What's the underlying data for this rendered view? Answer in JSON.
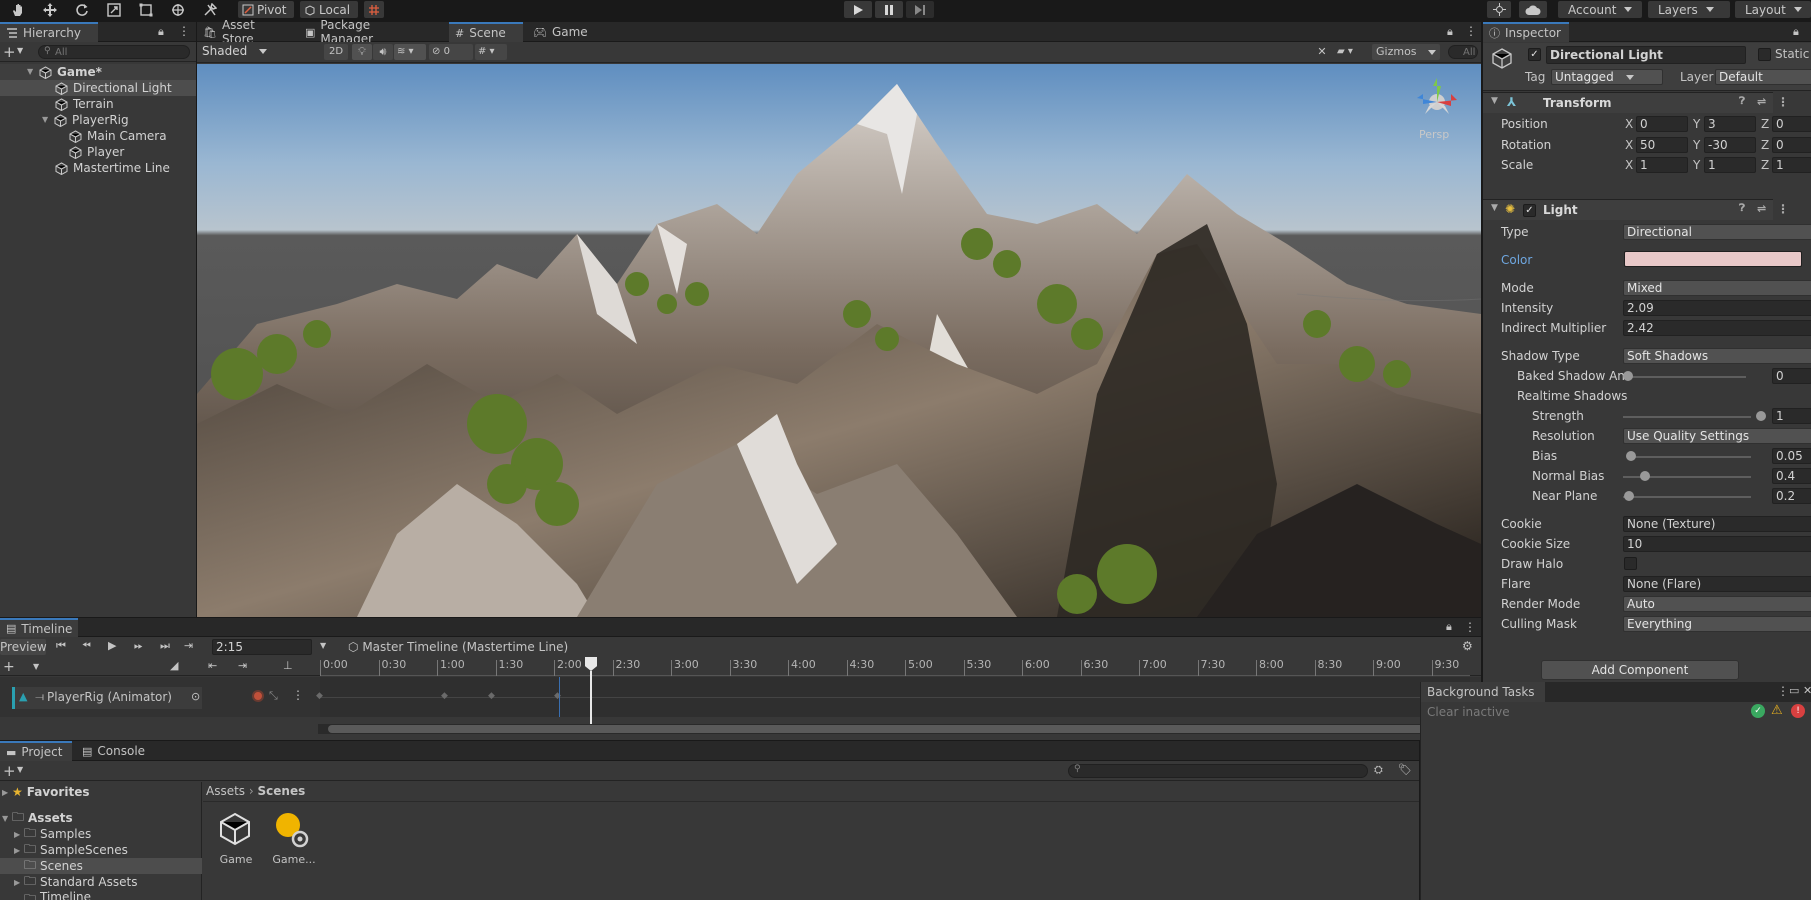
{
  "toolbar": {
    "pivot": "Pivot",
    "local": "Local",
    "account": "Account",
    "layers": "Layers",
    "layout": "Layout"
  },
  "hierarchy": {
    "title": "Hierarchy",
    "search_placeholder": "All",
    "items": [
      {
        "label": "Game*"
      },
      {
        "label": "Directional Light"
      },
      {
        "label": "Terrain"
      },
      {
        "label": "PlayerRig"
      },
      {
        "label": "Main Camera"
      },
      {
        "label": "Player"
      },
      {
        "label": "Mastertime Line"
      }
    ]
  },
  "center_tabs": {
    "asset_store": "Asset Store",
    "package_manager": "Package Manager",
    "scene": "Scene",
    "game": "Game"
  },
  "scene_toolbar": {
    "shading_mode": "Shaded",
    "mode_2d": "2D",
    "hidden_count": "0",
    "gizmos": "Gizmos",
    "search_placeholder": "All",
    "view_label": "Persp"
  },
  "inspector": {
    "title": "Inspector",
    "object_name": "Directional Light",
    "static_label": "Static",
    "tag_label": "Tag",
    "tag_value": "Untagged",
    "layer_label": "Layer",
    "layer_value": "Default",
    "transform": {
      "title": "Transform",
      "position_label": "Position",
      "rotation_label": "Rotation",
      "scale_label": "Scale",
      "position": {
        "x": "0",
        "y": "3",
        "z": "0"
      },
      "rotation": {
        "x": "50",
        "y": "-30",
        "z": "0"
      },
      "scale": {
        "x": "1",
        "y": "1",
        "z": "1"
      }
    },
    "light": {
      "title": "Light",
      "type_label": "Type",
      "type_value": "Directional",
      "color_label": "Color",
      "color_value": "#e8c8c8",
      "mode_label": "Mode",
      "mode_value": "Mixed",
      "intensity_label": "Intensity",
      "intensity_value": "2.09",
      "indirect_label": "Indirect Multiplier",
      "indirect_value": "2.42",
      "shadow_type_label": "Shadow Type",
      "shadow_type_value": "Soft Shadows",
      "baked_shadow_label": "Baked Shadow An",
      "baked_shadow_value": "0",
      "realtime_label": "Realtime Shadows",
      "strength_label": "Strength",
      "strength_value": "1",
      "resolution_label": "Resolution",
      "resolution_value": "Use Quality Settings",
      "bias_label": "Bias",
      "bias_value": "0.05",
      "normal_bias_label": "Normal Bias",
      "normal_bias_value": "0.4",
      "near_plane_label": "Near Plane",
      "near_plane_value": "0.2",
      "cookie_label": "Cookie",
      "cookie_value": "None (Texture)",
      "cookie_size_label": "Cookie Size",
      "cookie_size_value": "10",
      "draw_halo_label": "Draw Halo",
      "flare_label": "Flare",
      "flare_value": "None (Flare)",
      "render_mode_label": "Render Mode",
      "render_mode_value": "Auto",
      "culling_label": "Culling Mask",
      "culling_value": "Everything"
    },
    "add_component": "Add Component"
  },
  "timeline": {
    "title": "Timeline",
    "preview": "Preview",
    "time": "2:15",
    "master": "Master Timeline (Mastertime Line)",
    "track_label": "PlayerRig (Animator)",
    "ticks": [
      "0:00",
      "0:30",
      "1:00",
      "1:30",
      "2:00",
      "2:30",
      "3:00",
      "3:30",
      "4:00",
      "4:30",
      "5:00",
      "5:30",
      "6:00",
      "6:30",
      "7:00",
      "7:30",
      "8:00",
      "8:30",
      "9:00",
      "9:30"
    ]
  },
  "background_tasks": {
    "title": "Background Tasks",
    "clear_inactive": "Clear inactive"
  },
  "project": {
    "tab_project": "Project",
    "tab_console": "Console",
    "breadcrumb_root": "Assets",
    "breadcrumb_current": "Scenes",
    "tree": [
      {
        "label": "Favorites"
      },
      {
        "label": "Assets"
      },
      {
        "label": "Samples"
      },
      {
        "label": "SampleScenes"
      },
      {
        "label": "Scenes"
      },
      {
        "label": "Standard Assets"
      },
      {
        "label": "Timeline"
      }
    ],
    "files": [
      {
        "label": "Game"
      },
      {
        "label": "Game..."
      }
    ]
  }
}
